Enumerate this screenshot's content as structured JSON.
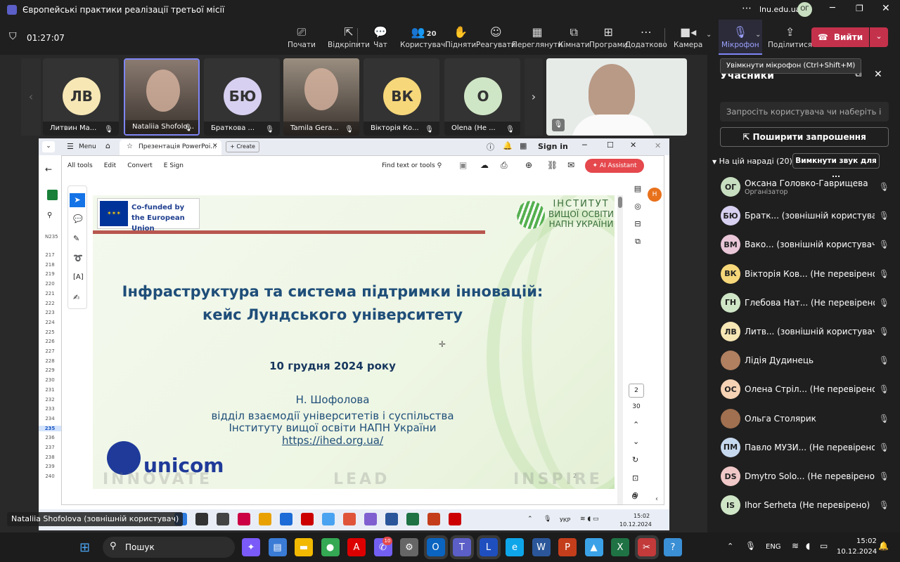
{
  "window": {
    "title": "Європейські практики реалізації третьої місії",
    "domain": "lnu.edu.ua",
    "user_initials": "ОГ"
  },
  "toolbar": {
    "timer": "01:27:07",
    "buttons": [
      {
        "label": "Почати",
        "icon": "share-icon"
      },
      {
        "label": "Відкріпити",
        "icon": "unpin-icon"
      },
      {
        "label": "Чат",
        "icon": "chat-icon"
      },
      {
        "label": "Користувачі",
        "icon": "people-icon",
        "badge": "20"
      },
      {
        "label": "Підняти",
        "icon": "hand-icon"
      },
      {
        "label": "Реагувати",
        "icon": "emoji-icon"
      },
      {
        "label": "Переглянути",
        "icon": "grid-icon"
      },
      {
        "label": "Кімнати",
        "icon": "rooms-icon"
      },
      {
        "label": "Програми",
        "icon": "apps-icon"
      },
      {
        "label": "Додатково",
        "icon": "more-icon"
      }
    ],
    "camera": "Камера",
    "mic": "Мікрофон",
    "share": "Поділитися",
    "leave": "Вийти"
  },
  "tooltip": "Увімкнути мікрофон (Ctrl+Shift+M)",
  "tiles": [
    {
      "initials": "ЛВ",
      "name": "Литвин Ма...",
      "color": "#f6e7b5"
    },
    {
      "initials": "",
      "name": "Nataliia Shofolo...",
      "color": "#8a7a70"
    },
    {
      "initials": "БЮ",
      "name": "Браткова ...",
      "color": "#d8d0f0"
    },
    {
      "initials": "",
      "name": "Tamila Gera...",
      "color": "#9a8e80"
    },
    {
      "initials": "ВК",
      "name": "Вікторія Ко...",
      "color": "#f6d77a"
    },
    {
      "initials": "О",
      "name": "Olena (Не ...",
      "color": "#cfe6c6"
    }
  ],
  "panel": {
    "title": "Учасники",
    "invite_placeholder": "Запросіть користувача чи наберіть і",
    "share_invite": "Поширити запрошення",
    "meeting_label": "На цій нараді (20)",
    "mute_all": "Вимкнути звук для ...",
    "participants": [
      {
        "initials": "ОГ",
        "name": "Оксана Головко-Гаврищева",
        "sub": "Організатор",
        "color": "#c7dec0"
      },
      {
        "initials": "БЮ",
        "name": "Братк... (зовнішній користувач)",
        "sub": "",
        "color": "#d8d0f0"
      },
      {
        "initials": "ВМ",
        "name": "Вако... (зовнішній користувач)",
        "sub": "",
        "color": "#e9c6d8"
      },
      {
        "initials": "ВК",
        "name": "Вікторія Ков... (Не перевірено)",
        "sub": "",
        "color": "#f6d77a"
      },
      {
        "initials": "ГН",
        "name": "Глебова Нат... (Не перевірено)",
        "sub": "",
        "color": "#cfe6c6"
      },
      {
        "initials": "ЛВ",
        "name": "Литв... (зовнішній користувач)",
        "sub": "",
        "color": "#f6e7b5"
      },
      {
        "initials": "",
        "name": "Лідія Дудинець",
        "sub": "",
        "color": "#b08060"
      },
      {
        "initials": "ОС",
        "name": "Олена Стріл... (Не перевірено)",
        "sub": "",
        "color": "#f6d3b5"
      },
      {
        "initials": "",
        "name": "Ольга Столярик",
        "sub": "",
        "color": "#a07050"
      },
      {
        "initials": "ПМ",
        "name": "Павло МУЗИ... (Не перевірено)",
        "sub": "",
        "color": "#c6d8ee"
      },
      {
        "initials": "DS",
        "name": "Dmytro Solo... (Не перевірено)",
        "sub": "",
        "color": "#f0c8c8"
      },
      {
        "initials": "IS",
        "name": "Ihor Serheta (Не перевірено)",
        "sub": "",
        "color": "#cfe6c6"
      }
    ]
  },
  "shared": {
    "tab_menu": "Menu",
    "tab_title": "Презентація PowerPoi...",
    "tab_create": "Create",
    "sign_in": "Sign in",
    "menu": [
      "All tools",
      "Edit",
      "Convert",
      "E Sign"
    ],
    "find": "Find text or tools",
    "ai": "AI Assistant",
    "page_current": "2",
    "page_total": "30",
    "cell_ref": "N235",
    "rows": [
      "217",
      "218",
      "219",
      "220",
      "221",
      "222",
      "223",
      "224",
      "225",
      "226",
      "227",
      "228",
      "229",
      "230",
      "231",
      "232",
      "233",
      "234",
      "235",
      "236",
      "237",
      "238",
      "239",
      "240"
    ]
  },
  "slide": {
    "eu": "Co-funded by the European Union",
    "inst1": "ІНСТИТУТ",
    "inst2": "ВИЩОЇ ОСВІТИ",
    "inst3": "НАПН УКРАЇНИ",
    "title1": "Інфраструктура та система підтримки інновацій:",
    "title2": "кейс Лундського університету",
    "date": "10 грудня 2024 року",
    "author": "Н. Шофолова",
    "dept1": "відділ взаємодії університетів і суспільства",
    "dept2": "Інституту вищої освіти НАПН України",
    "url": "https://ihed.org.ua/",
    "logo": "unicom",
    "w1": "INNOVATE",
    "w2": "LEAD",
    "w3": "INSPIRE",
    "num": "2"
  },
  "presenter": "Nataliia Shofolova (зовнішній користувач)",
  "inner_taskbar": {
    "lang": "УКР",
    "time": "15:02",
    "date": "10.12.2024"
  },
  "taskbar": {
    "search": "Пошук",
    "lang": "ENG",
    "time": "15:02",
    "date": "10.12.2024",
    "badge": "10"
  }
}
